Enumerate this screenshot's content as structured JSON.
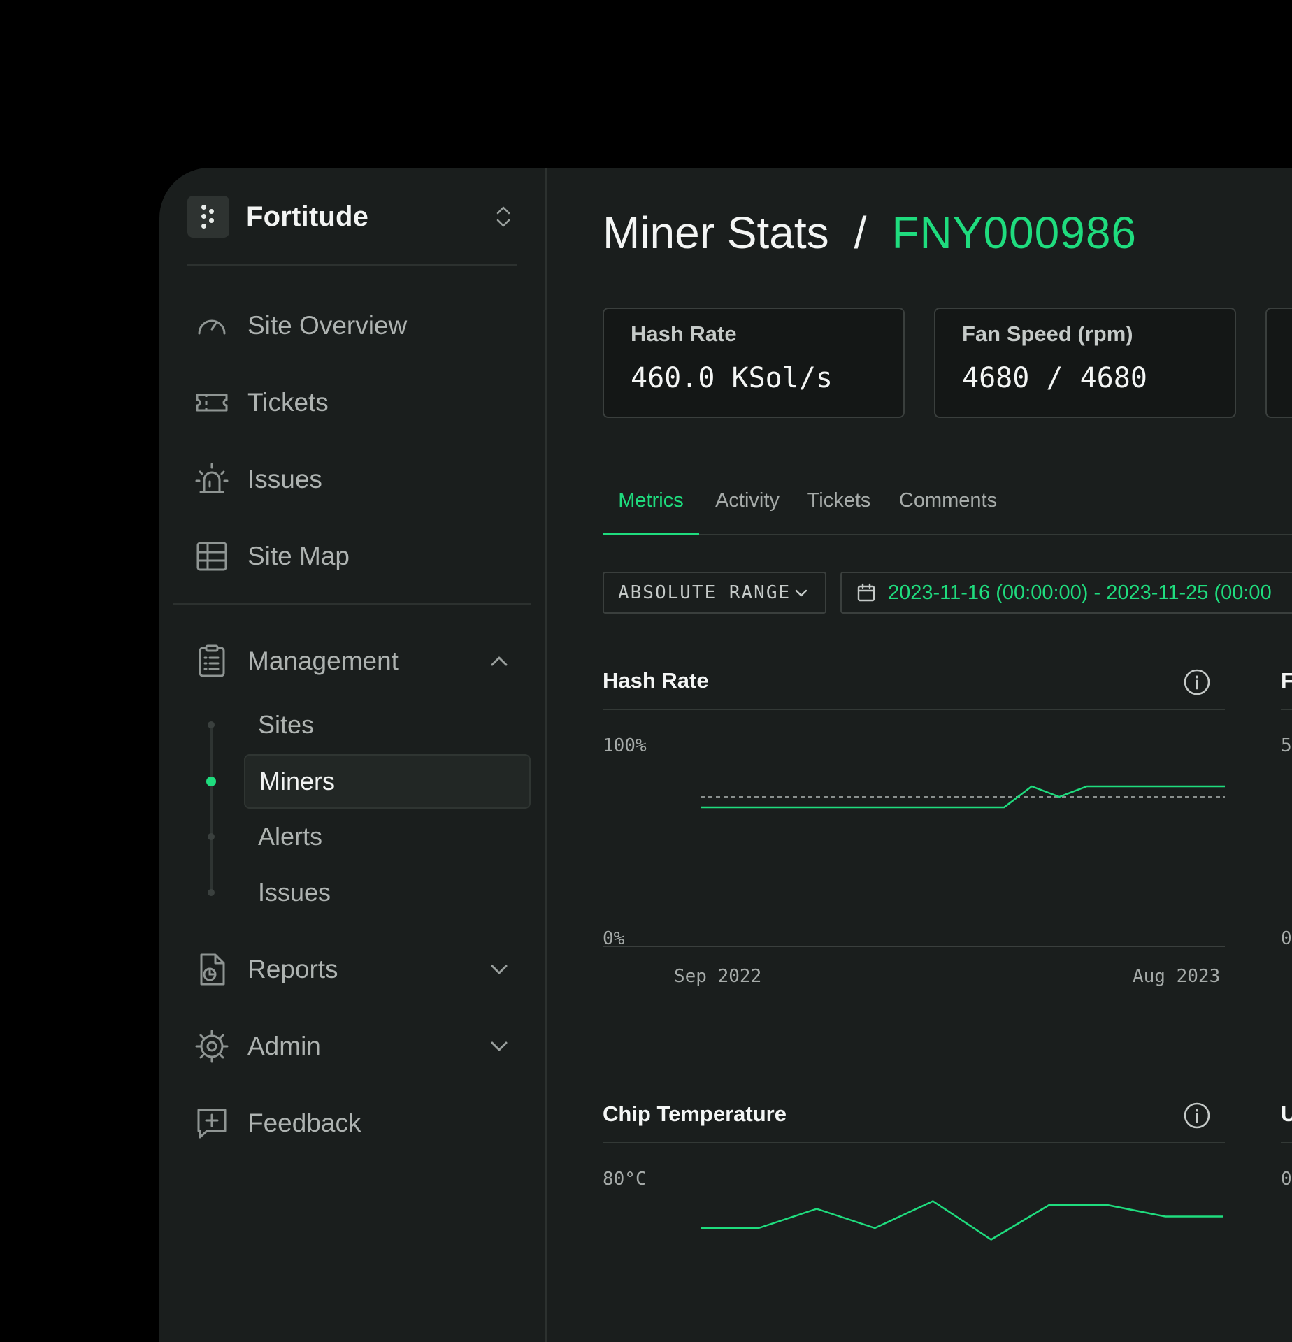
{
  "sidebar": {
    "brand": {
      "name": "Fortitude",
      "logo_icon": "fortitude-logo-icon",
      "toggle_icon": "chevrons-up-down-icon"
    },
    "nav": [
      {
        "label": "Site Overview",
        "icon": "gauge-icon"
      },
      {
        "label": "Tickets",
        "icon": "ticket-icon"
      },
      {
        "label": "Issues",
        "icon": "siren-icon"
      },
      {
        "label": "Site Map",
        "icon": "grid-icon"
      }
    ],
    "management": {
      "label": "Management",
      "icon": "clipboard-list-icon",
      "expanded": true,
      "items": [
        {
          "label": "Sites",
          "active": false
        },
        {
          "label": "Miners",
          "active": true
        },
        {
          "label": "Alerts",
          "active": false
        },
        {
          "label": "Issues",
          "active": false
        }
      ]
    },
    "reports": {
      "label": "Reports",
      "icon": "report-icon",
      "expanded": false
    },
    "admin": {
      "label": "Admin",
      "icon": "settings-gear-icon",
      "expanded": false
    },
    "feedback": {
      "label": "Feedback",
      "icon": "message-plus-icon"
    }
  },
  "header": {
    "title": "Miner Stats",
    "separator": "/",
    "miner_id": "FNY000986"
  },
  "stats": [
    {
      "label": "Hash Rate",
      "value": "460.0 KSol/s"
    },
    {
      "label": "Fan Speed (rpm)",
      "value": "4680 / 4680"
    }
  ],
  "tabs": [
    {
      "label": "Metrics",
      "active": true
    },
    {
      "label": "Activity",
      "active": false
    },
    {
      "label": "Tickets",
      "active": false
    },
    {
      "label": "Comments",
      "active": false
    }
  ],
  "filter": {
    "range_type": "ABSOLUTE RANGE",
    "date_range": "2023-11-16 (00:00:00) - 2023-11-25 (00:00"
  },
  "colors": {
    "accent": "#1fdc7e",
    "background": "#1a1e1d",
    "page": "#000000",
    "muted_text": "#aeb3b1"
  },
  "panels": {
    "hash_rate": {
      "title": "Hash Rate",
      "y_top": "100%",
      "y_bottom": "0%",
      "x_start": "Sep 2022",
      "x_end": "Aug 2023",
      "right_peek_title": "F",
      "right_peek_top": "5",
      "right_peek_bottom": "0"
    },
    "chip_temp": {
      "title": "Chip Temperature",
      "y_top": "80°C",
      "right_peek_title": "U",
      "right_peek_top": "0"
    }
  },
  "chart_data": [
    {
      "type": "line",
      "title": "Hash Rate",
      "ylim": [
        0,
        100
      ],
      "y_tick_labels": [
        "0%",
        "100%"
      ],
      "x_tick_labels": [
        "Sep 2022",
        "Aug 2023"
      ],
      "reference_line": 84,
      "series": [
        {
          "values": [
            78,
            78,
            78,
            78,
            78,
            78,
            78,
            78,
            78,
            78,
            78,
            78,
            90,
            84,
            90,
            90,
            90,
            90,
            90,
            90
          ]
        }
      ]
    },
    {
      "type": "line",
      "title": "Chip Temperature",
      "y_tick_labels": [
        "80°C"
      ],
      "series": [
        {
          "values": [
            66,
            66,
            71,
            66,
            73,
            63,
            72,
            72,
            69,
            69
          ]
        }
      ]
    }
  ]
}
